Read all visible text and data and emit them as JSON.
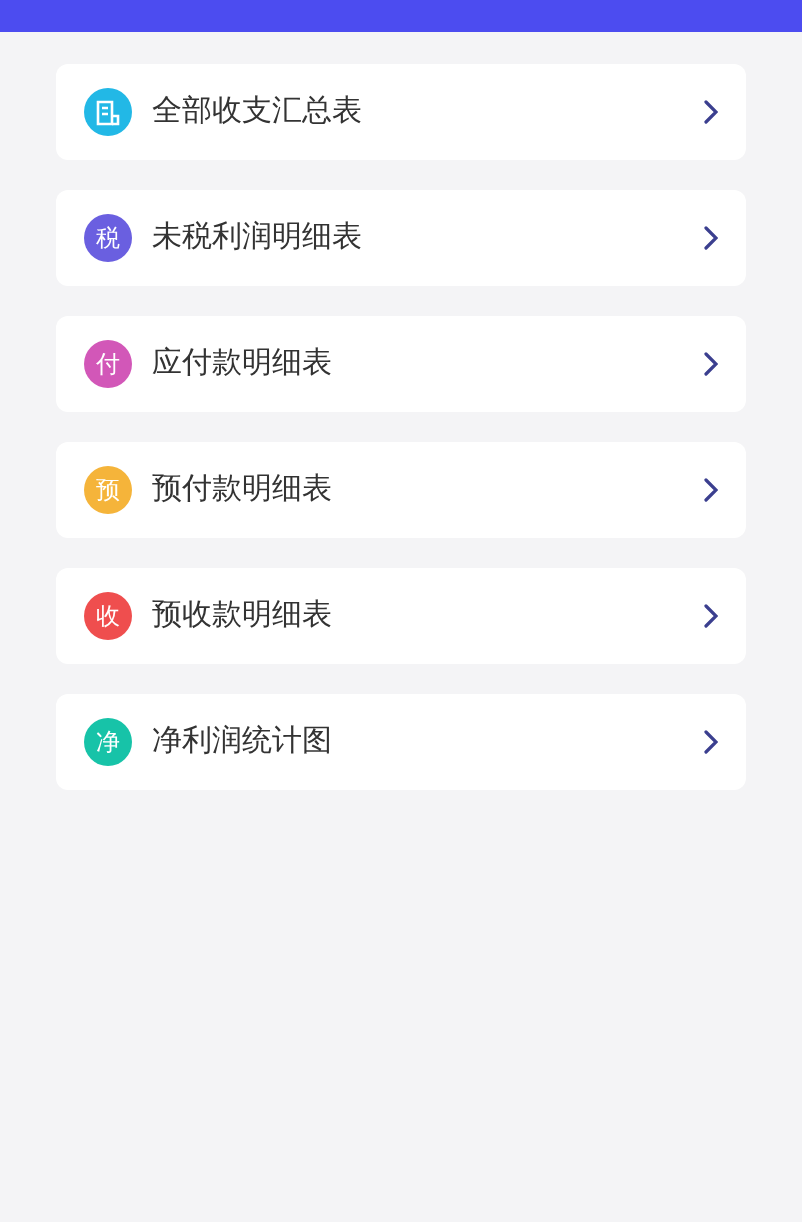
{
  "items": [
    {
      "label": "全部收支汇总表",
      "kind": "document",
      "color": "#22b8e6"
    },
    {
      "label": "未税利润明细表",
      "kind": "char",
      "glyph": "税",
      "color": "#6a5fe0"
    },
    {
      "label": "应付款明细表",
      "kind": "char",
      "glyph": "付",
      "color": "#d257b8"
    },
    {
      "label": "预付款明细表",
      "kind": "char",
      "glyph": "预",
      "color": "#f5b43a"
    },
    {
      "label": "预收款明细表",
      "kind": "char",
      "glyph": "收",
      "color": "#ef4e4e"
    },
    {
      "label": "净利润统计图",
      "kind": "char",
      "glyph": "净",
      "color": "#17c3a8"
    }
  ]
}
